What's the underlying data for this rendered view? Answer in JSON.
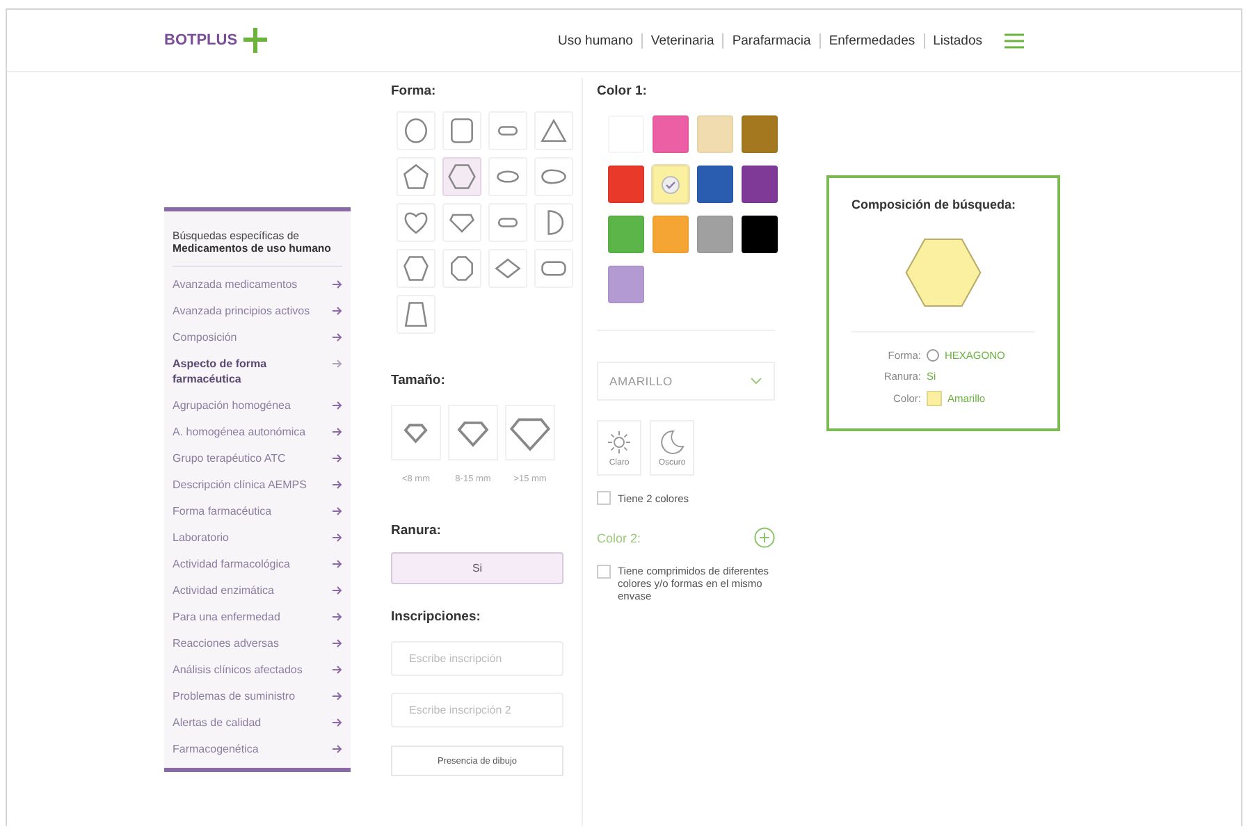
{
  "header": {
    "logo": "BOTPLUS",
    "nav": [
      {
        "label": "Uso humano"
      },
      {
        "label": "Veterinaria"
      },
      {
        "label": "Parafarmacia"
      },
      {
        "label": "Enfermedades"
      },
      {
        "label": "Listados"
      }
    ]
  },
  "sidebar": {
    "intro": "Búsquedas específicas de",
    "title": "Medicamentos de uso humano",
    "items": [
      {
        "label": "Avanzada medicamentos",
        "selected": false
      },
      {
        "label": "Avanzada principios activos",
        "selected": false
      },
      {
        "label": "Composición",
        "selected": false
      },
      {
        "label": "Aspecto de forma farmacéutica",
        "selected": true
      },
      {
        "label": "Agrupación homogénea",
        "selected": false
      },
      {
        "label": "A. homogénea autonómica",
        "selected": false
      },
      {
        "label": "Grupo terapéutico ATC",
        "selected": false
      },
      {
        "label": "Descripción clínica AEMPS",
        "selected": false
      },
      {
        "label": "Forma farmacéutica",
        "selected": false
      },
      {
        "label": "Laboratorio",
        "selected": false
      },
      {
        "label": "Actividad farmacológica",
        "selected": false
      },
      {
        "label": "Actividad enzimática",
        "selected": false
      },
      {
        "label": "Para una enfermedad",
        "selected": false
      },
      {
        "label": "Reacciones adversas",
        "selected": false
      },
      {
        "label": "Análisis clínicos afectados",
        "selected": false
      },
      {
        "label": "Problemas de suministro",
        "selected": false
      },
      {
        "label": "Alertas de calidad",
        "selected": false
      },
      {
        "label": "Farmacogenética",
        "selected": false
      }
    ]
  },
  "forma": {
    "title": "Forma:",
    "shapes": [
      {
        "kind": "circle",
        "selected": false
      },
      {
        "kind": "square",
        "selected": false
      },
      {
        "kind": "capsule",
        "selected": false
      },
      {
        "kind": "triangle",
        "selected": false
      },
      {
        "kind": "pentagon",
        "selected": false
      },
      {
        "kind": "hexagon",
        "selected": true
      },
      {
        "kind": "oval",
        "selected": false
      },
      {
        "kind": "egg",
        "selected": false
      },
      {
        "kind": "heart",
        "selected": false
      },
      {
        "kind": "shield",
        "selected": false
      },
      {
        "kind": "capsule",
        "selected": false
      },
      {
        "kind": "half",
        "selected": false
      },
      {
        "kind": "heptagon",
        "selected": false
      },
      {
        "kind": "octagon",
        "selected": false
      },
      {
        "kind": "rhombus",
        "selected": false
      },
      {
        "kind": "rect",
        "selected": false
      },
      {
        "kind": "trapezoid",
        "selected": false
      }
    ]
  },
  "tamano": {
    "title": "Tamaño:",
    "sizes": [
      {
        "kind": "small",
        "label": "<8 mm",
        "selected": false
      },
      {
        "kind": "medium",
        "label": "8-15 mm",
        "selected": false
      },
      {
        "kind": "large",
        "label": ">15 mm",
        "selected": false
      }
    ]
  },
  "ranura": {
    "title": "Ranura:",
    "option": {
      "label": "Si",
      "selected": true
    }
  },
  "inscripciones": {
    "title": "Inscripciones:",
    "fields": [
      {
        "placeholder": "Escribe inscripción"
      },
      {
        "placeholder": "Escribe inscripción 2"
      }
    ],
    "button": "Presencia de dibujo"
  },
  "color1": {
    "title": "Color 1:",
    "swatches": [
      {
        "color": "#ffffff",
        "selected": false
      },
      {
        "color": "#ec5fa4",
        "selected": false
      },
      {
        "color": "#f0dcae",
        "selected": false
      },
      {
        "color": "#a4781e",
        "selected": false
      },
      {
        "color": "#e8392b",
        "selected": false
      },
      {
        "color": "#fbf0a0",
        "selected": true
      },
      {
        "color": "#2a5db0",
        "selected": false
      },
      {
        "color": "#7f3a98",
        "selected": false
      },
      {
        "color": "#5cb548",
        "selected": false
      },
      {
        "color": "#f5a534",
        "selected": false
      },
      {
        "color": "#a0a0a0",
        "selected": false
      },
      {
        "color": "#000000",
        "selected": false
      },
      {
        "color": "#b49ad2",
        "selected": false
      }
    ],
    "dropdown": "AMARILLO",
    "tones": [
      {
        "kind": "light",
        "label": "Claro",
        "selected": false
      },
      {
        "kind": "dark",
        "label": "Oscuro",
        "selected": false
      }
    ],
    "two_colors": {
      "label": "Tiene 2 colores",
      "checked": false
    }
  },
  "color2": {
    "title": "Color 2:",
    "different": {
      "label": "Tiene comprimidos de diferentes colores y/o formas en el mismo envase",
      "checked": false
    }
  },
  "summary": {
    "title": "Composición de búsqueda:",
    "rows": [
      {
        "kind": "shape",
        "label": "Forma:",
        "value": "HEXAGONO"
      },
      {
        "kind": "text",
        "label": "Ranura:",
        "value": "Si"
      },
      {
        "kind": "color",
        "label": "Color:",
        "value": "Amarillo"
      }
    ]
  }
}
